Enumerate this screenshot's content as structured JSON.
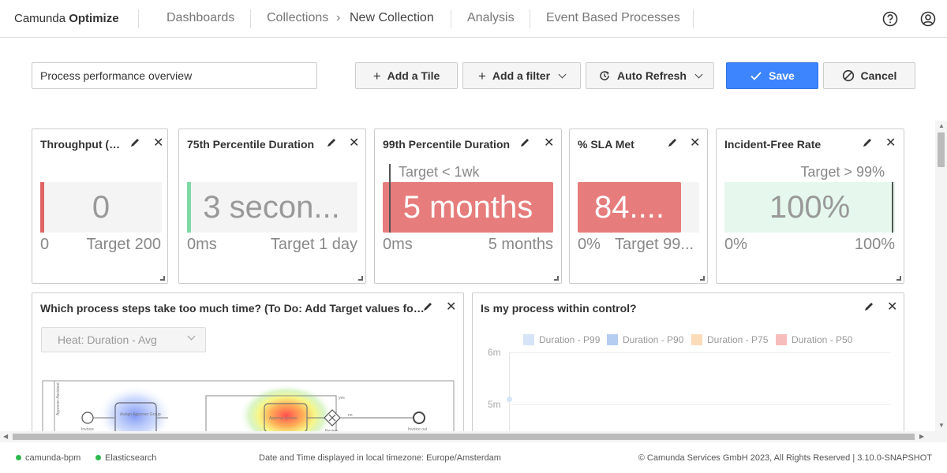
{
  "header": {
    "brand_prefix": "Camunda",
    "brand_product": "Optimize",
    "nav": {
      "dashboards": "Dashboards",
      "collections": "Collections",
      "crumb_separator": "›",
      "current": "New Collection",
      "analysis": "Analysis",
      "event_processes": "Event Based Processes"
    },
    "help_icon": "help-circle-icon",
    "user_icon": "user-circle-icon"
  },
  "toolbar": {
    "name_value": "Process performance overview",
    "add_tile": "Add a Tile",
    "add_filter": "Add a filter",
    "auto_refresh": "Auto Refresh",
    "save": "Save",
    "cancel": "Cancel",
    "plus_glyph": "+"
  },
  "tiles": {
    "throughput": {
      "title": "Throughput (3...",
      "value": "0",
      "min": "0",
      "max": "Target 200",
      "fill": 0.0
    },
    "p75": {
      "title": "75th Percentile Duration",
      "value": "3 secon...",
      "min": "0ms",
      "max": "Target 1 day",
      "fill": 0.0
    },
    "p99": {
      "title": "99th Percentile Duration",
      "value": "5 months",
      "min": "0ms",
      "max": "5 months",
      "target": "Target < 1wk",
      "fill": 1.0
    },
    "sla": {
      "title": "% SLA Met",
      "value": "84....",
      "min": "0%",
      "max": "Target 99...",
      "fill": 0.84
    },
    "incident": {
      "title": "Incident-Free Rate",
      "value": "100%",
      "min": "0%",
      "max": "100%",
      "target": "Target > 99%",
      "fill": 1.0
    },
    "heatmap": {
      "title": "Which process steps take too much time? (To Do: Add Target values for thes...",
      "select_value": "Heat: Duration - Avg",
      "diagram": {
        "lane_label": "Approver Assistant",
        "start_label": "Invoice",
        "task_label": "Assign Approver Group",
        "gateway_label": "Review",
        "yes_label": "yes",
        "no_label": "no",
        "end_label": "Invoice out",
        "task2_label": "Approve Invoice"
      }
    },
    "control": {
      "title": "Is my process within control?",
      "legend": [
        {
          "name": "Duration - P99",
          "color": "#d6e4f7"
        },
        {
          "name": "Duration - P90",
          "color": "#b4cdf0"
        },
        {
          "name": "Duration - P75",
          "color": "#fbdcb8"
        },
        {
          "name": "Duration - P50",
          "color": "#f7bcbc"
        }
      ],
      "y_ticks": [
        "6m",
        "5m"
      ]
    }
  },
  "colors": {
    "red_fill": "#e77c7c",
    "red_bar": "#e06666",
    "green_bar": "#7fd9a7",
    "green_fill": "#e6f8ee",
    "primary": "#3c85ff"
  },
  "footer": {
    "engine": "camunda-bpm",
    "search": "Elasticsearch",
    "timezone": "Date and Time displayed in local timezone: Europe/Amsterdam",
    "copyright": "© Camunda Services GmbH 2023, All Rights Reserved | 3.10.0-SNAPSHOT"
  }
}
